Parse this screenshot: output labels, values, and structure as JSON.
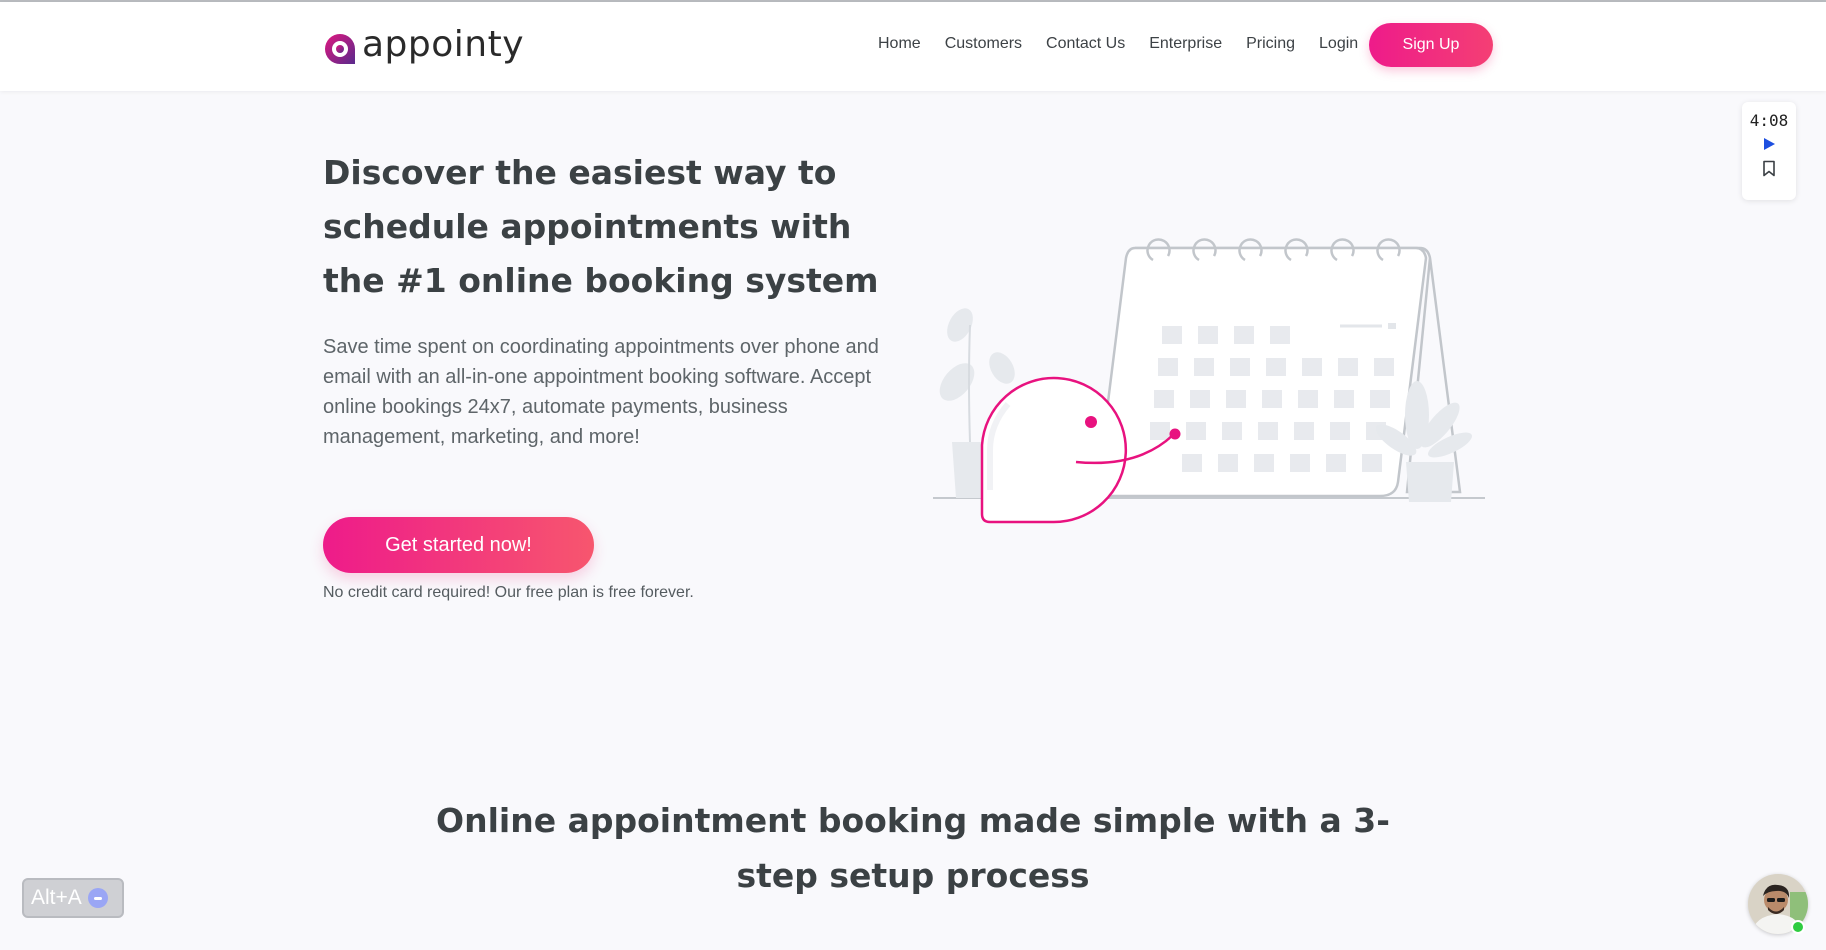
{
  "brand": {
    "name": "appointy",
    "accent": "#ee1b8a",
    "logo_color": "#8a1d8f"
  },
  "nav": {
    "items": [
      {
        "label": "Home"
      },
      {
        "label": "Customers"
      },
      {
        "label": "Contact Us"
      },
      {
        "label": "Enterprise"
      },
      {
        "label": "Pricing"
      },
      {
        "label": "Login"
      }
    ],
    "signup_label": "Sign Up"
  },
  "video_widget": {
    "time": "4:08",
    "icons": [
      "play-icon",
      "bookmark-icon"
    ]
  },
  "hero": {
    "title": "Discover the easiest way to schedule appointments with the #1 online booking system",
    "description": "Save time spent on coordinating appointments over phone and email with an all-in-one appointment booking software. Accept online bookings 24x7, automate payments, business management, marketing, and more!",
    "cta_label": "Get started now!",
    "cta_note": "No credit card required! Our free plan is free forever."
  },
  "section": {
    "title": "Online appointment booking made simple with a 3-step setup process"
  },
  "accessibility_widget": {
    "label": "Alt+A"
  },
  "chat_avatar": {
    "status_color": "#2ecc40"
  }
}
